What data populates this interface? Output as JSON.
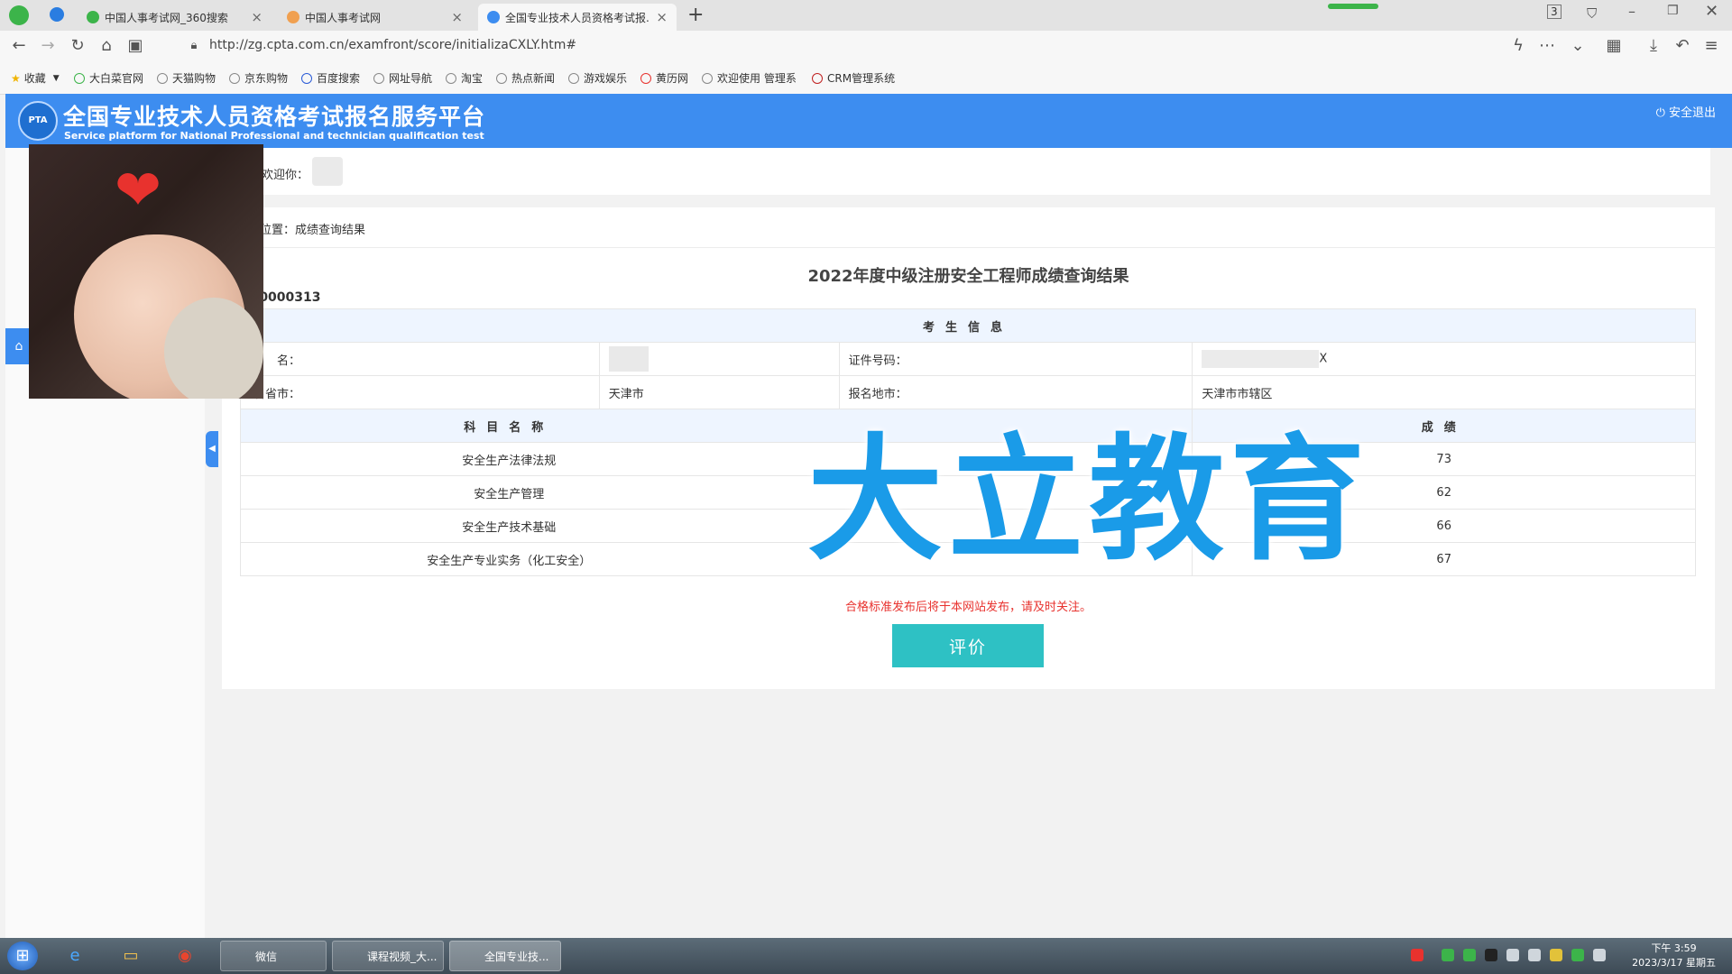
{
  "browser": {
    "tabs": [
      {
        "label": "中国人事考试网_360搜索",
        "active": false
      },
      {
        "label": "中国人事考试网",
        "active": false
      },
      {
        "label": "全国专业技术人员资格考试报...",
        "active": true
      }
    ],
    "new_tab": "+",
    "url": "http://zg.cpta.com.cn/examfront/score/initializaCXLY.htm#",
    "tab_count_badge": "3",
    "bookmarks": [
      "收藏",
      "大白菜官网",
      "天猫购物",
      "京东购物",
      "百度搜索",
      "网址导航",
      "淘宝",
      "热点新闻",
      "游戏娱乐",
      "黄历网",
      "欢迎使用 管理系",
      "CRM管理系统"
    ]
  },
  "site": {
    "logo_text": "PTA",
    "title": "全国专业技术人员资格考试报名服务平台",
    "subtitle": "Service platform for National Professional and technician qualification test",
    "logout": "安全退出"
  },
  "welcome": "欢迎你：",
  "breadcrumb": "位置：成绩查询结果",
  "result": {
    "title": "2022年度中级注册安全工程师成绩查询结果",
    "ticket_no": ".0000313",
    "info_header": "考生信息",
    "name_label": "名：",
    "id_label": "证件号码：",
    "id_suffix": "X",
    "province_label": "名省市：",
    "province_value": "天津市",
    "region_label": "报名地市：",
    "region_value": "天津市市辖区",
    "subject_header": "科目名称",
    "score_header": "成绩",
    "subjects": [
      {
        "name": "安全生产法律法规",
        "score": "73"
      },
      {
        "name": "安全生产管理",
        "score": "62"
      },
      {
        "name": "安全生产技术基础",
        "score": "66"
      },
      {
        "name": "安全生产专业实务（化工安全）",
        "score": "67"
      }
    ],
    "notice": "合格标准发布后将于本网站发布，请及时关注。",
    "evaluate_button": "评价"
  },
  "watermark": "大立教育",
  "taskbar": {
    "tasks": [
      "微信",
      "课程视频_大...",
      "全国专业技..."
    ],
    "time": "下午 3:59",
    "date": "2023/3/17 星期五"
  },
  "colors": {
    "header_blue": "#3d8df0",
    "button_teal": "#2ec1c4",
    "notice_red": "#e8322e",
    "watermark_blue": "#1a9be8"
  }
}
